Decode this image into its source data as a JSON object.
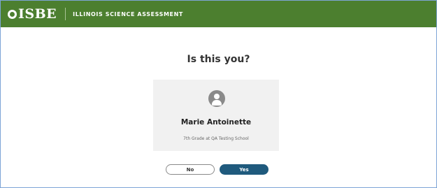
{
  "header": {
    "logo_text": "ISBE",
    "title": "ILLINOIS SCIENCE ASSESSMENT",
    "background_color": "#4c7f2f"
  },
  "main": {
    "question": "Is this you?",
    "student": {
      "avatar_icon": "user-avatar-icon",
      "name": "Marie Antoinette",
      "details": "7th Grade at QA Testing School"
    },
    "buttons": {
      "no_label": "No",
      "yes_label": "Yes",
      "yes_color": "#1f5a7d"
    }
  }
}
